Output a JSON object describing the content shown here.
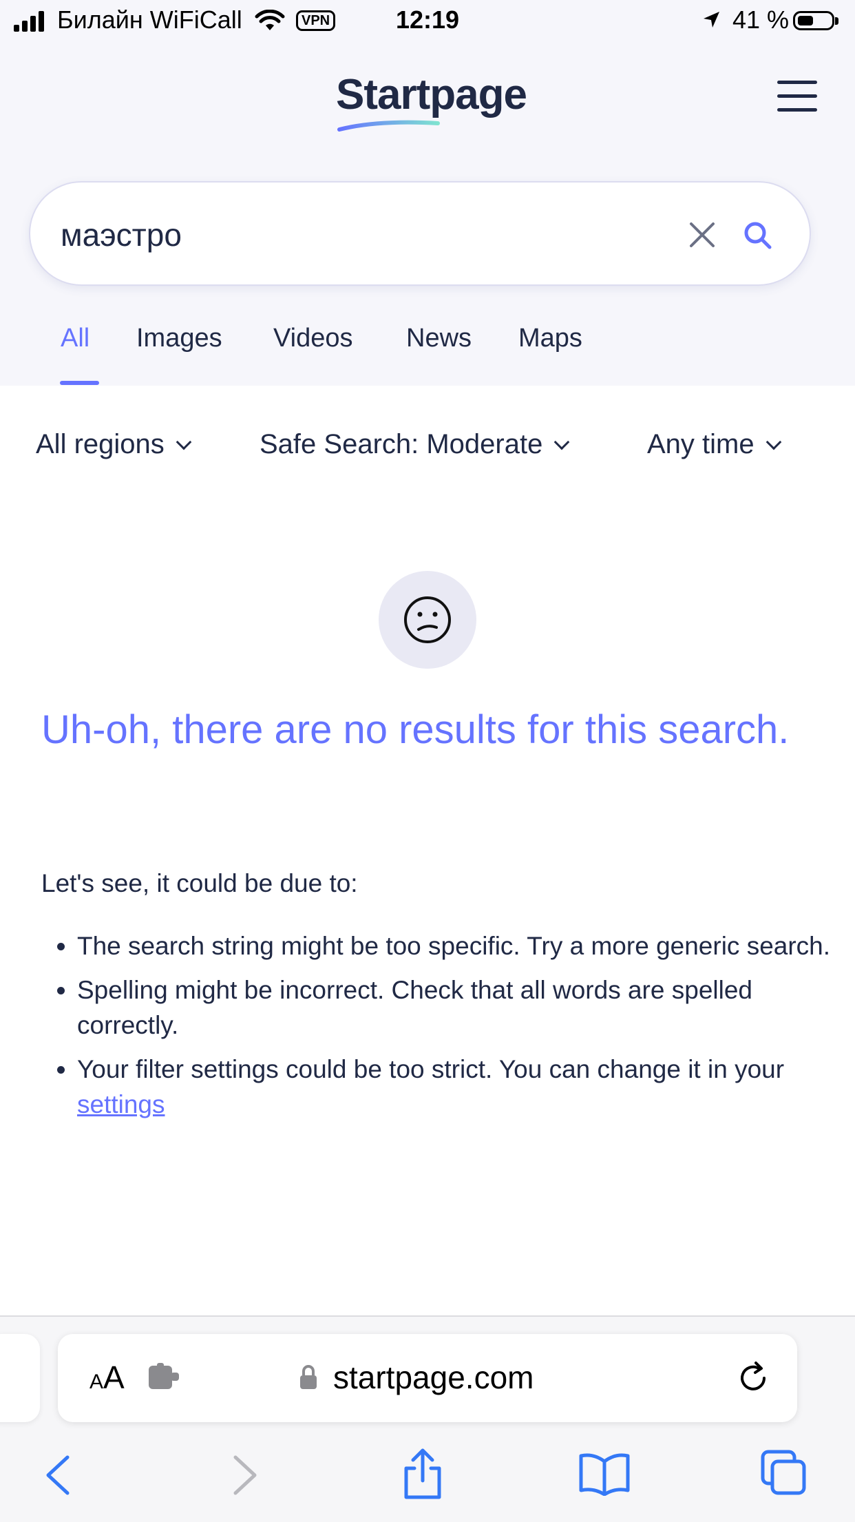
{
  "status_bar": {
    "carrier": "Билайн WiFiCall",
    "vpn": "VPN",
    "time": "12:19",
    "battery": "41 %"
  },
  "header": {
    "logo": "Startpage",
    "menu_icon": "hamburger-menu-icon"
  },
  "search": {
    "query": "маэстро",
    "clear_icon": "close-icon",
    "search_icon": "search-icon"
  },
  "tabs": [
    {
      "label": "All",
      "active": true
    },
    {
      "label": "Images",
      "active": false
    },
    {
      "label": "Videos",
      "active": false
    },
    {
      "label": "News",
      "active": false
    },
    {
      "label": "Maps",
      "active": false
    }
  ],
  "filters": {
    "region": "All regions",
    "safe_search": "Safe Search: Moderate",
    "time": "Any time"
  },
  "empty_state": {
    "icon": "sad-face-icon",
    "headline": "Uh-oh, there are no results for this search.",
    "lead": "Let's see, it could be due to:",
    "reasons": [
      "The search string might be too specific. Try a more generic search.",
      "Spelling might be incorrect. Check that all words are spelled correctly.",
      "Your filter settings could be too strict. You can change it in your"
    ],
    "settings_link": "settings"
  },
  "browser": {
    "text_size_label": "AA",
    "url": "startpage.com"
  },
  "colors": {
    "accent": "#6573ff",
    "text": "#202945",
    "header_bg": "#f6f6fb",
    "ios_blue": "#3478f6"
  }
}
